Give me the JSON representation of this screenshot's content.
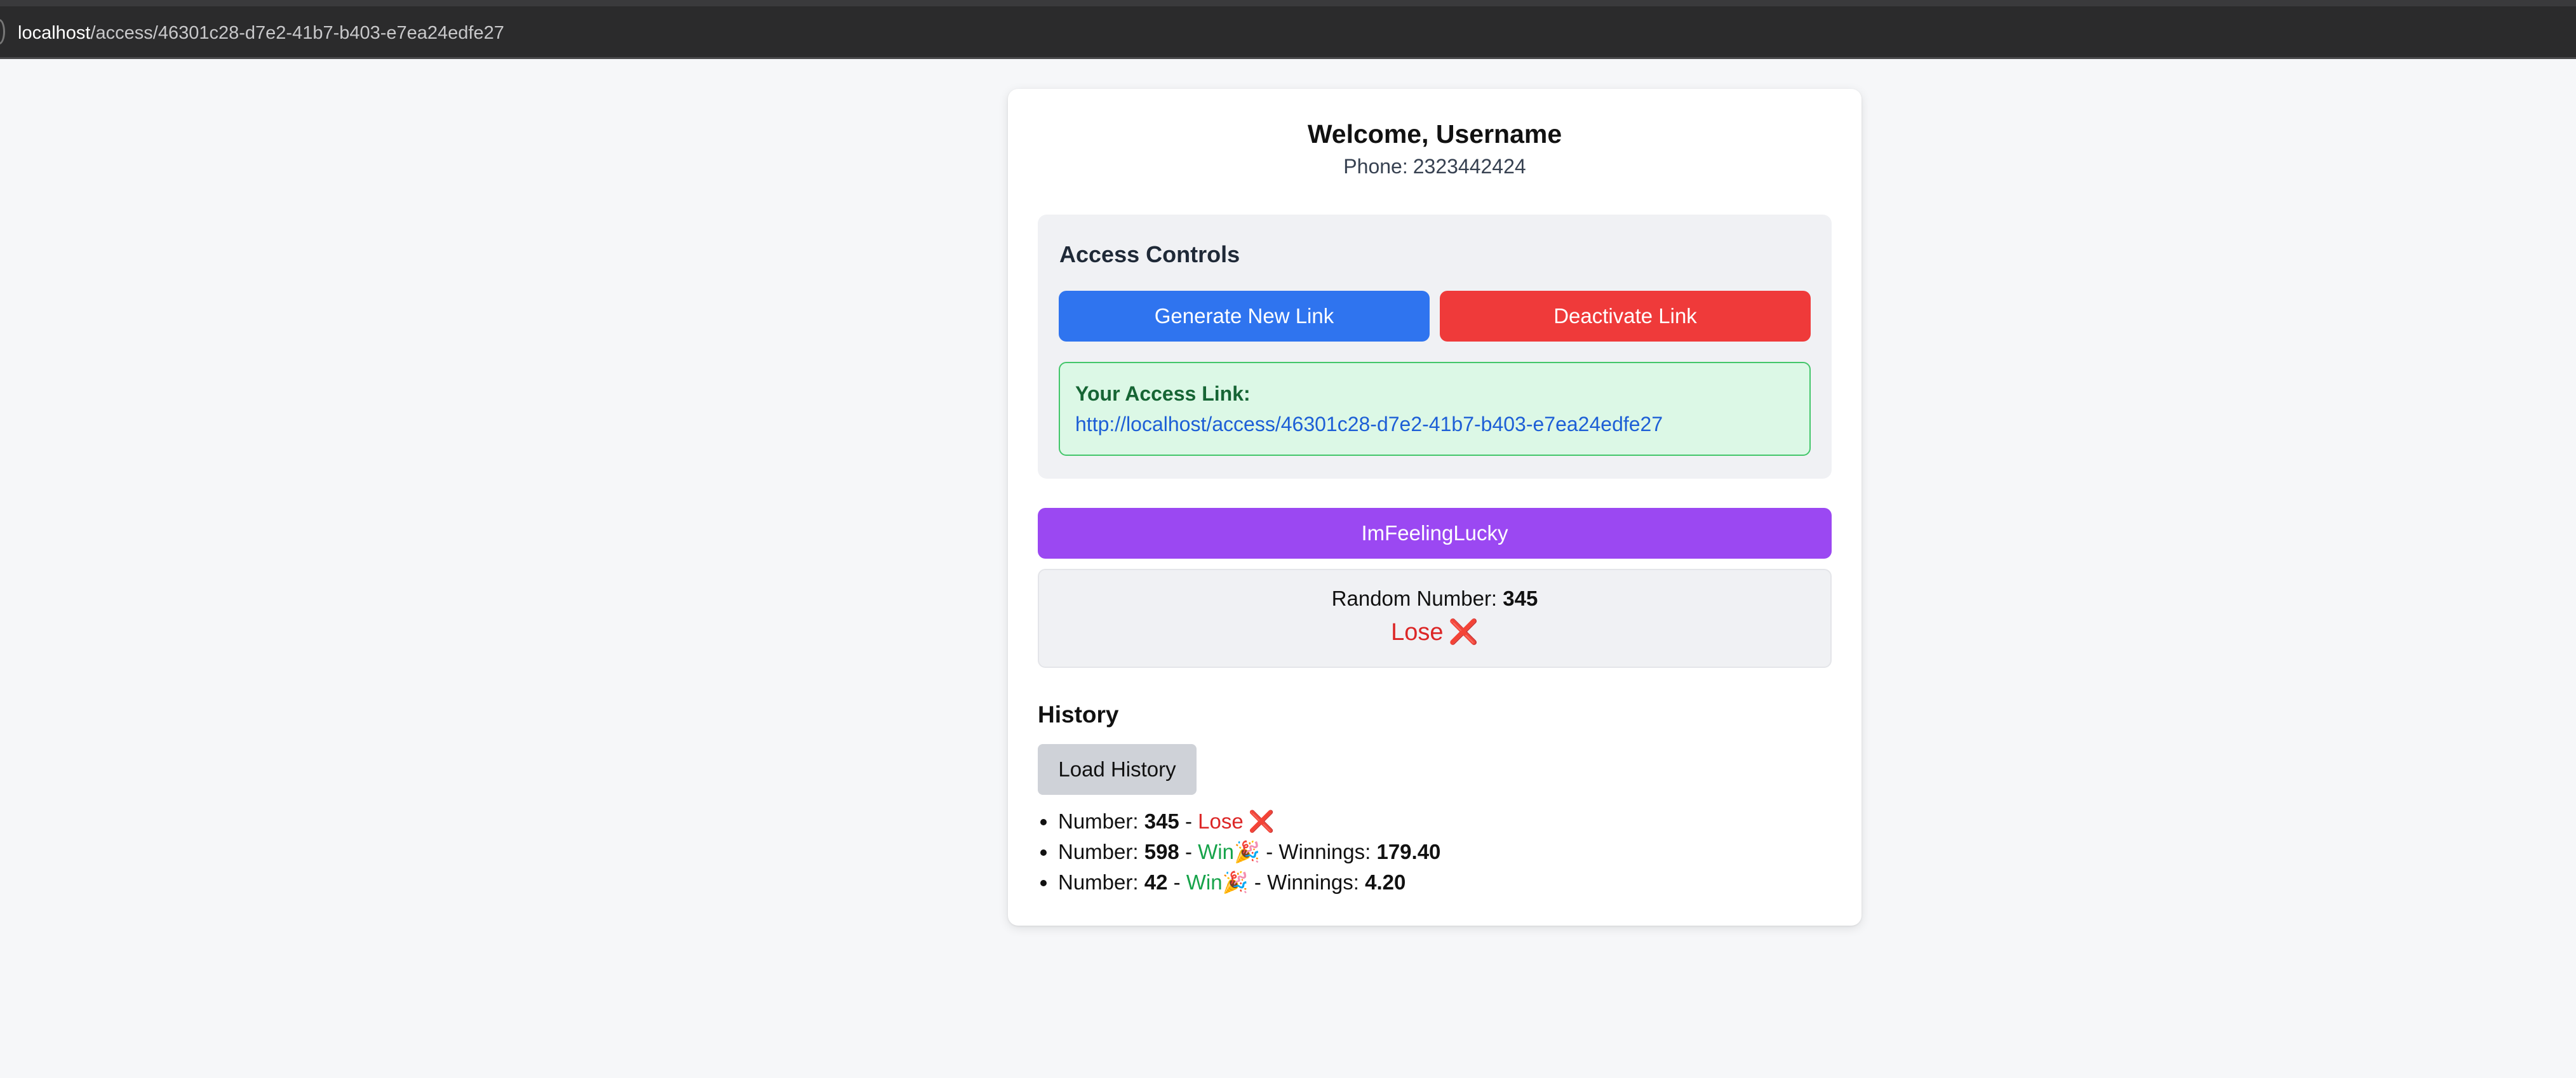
{
  "browser": {
    "url_host": "localhost",
    "url_path": "/access/46301c28-d7e2-41b7-b403-e7ea24edfe27"
  },
  "user": {
    "welcome": "Welcome, Username",
    "phone_label": "Phone:",
    "phone_value": "2323442424"
  },
  "access_controls": {
    "title": "Access Controls",
    "generate_label": "Generate New Link",
    "deactivate_label": "Deactivate Link",
    "link_label": "Your Access Link:",
    "link_url": "http://localhost/access/46301c28-d7e2-41b7-b403-e7ea24edfe27"
  },
  "lucky": {
    "button_label": "ImFeelingLucky",
    "random_label": "Random Number:",
    "random_value": "345",
    "status": "Lose",
    "status_icon": "❌"
  },
  "history": {
    "title": "History",
    "load_label": "Load History",
    "number_label": "Number:",
    "winnings_label": "Winnings:",
    "sep": "-",
    "items": [
      {
        "number": "345",
        "result": "Lose",
        "icon": "❌",
        "winnings": null
      },
      {
        "number": "598",
        "result": "Win",
        "icon": "🎉",
        "winnings": "179.40"
      },
      {
        "number": "42",
        "result": "Win",
        "icon": "🎉",
        "winnings": "4.20"
      }
    ]
  },
  "colors": {
    "primary_blue": "#2f74ef",
    "danger_red": "#ef3a3a",
    "purple": "#9b48f2",
    "success_green": "#16a34a",
    "lose_red": "#dc2626"
  }
}
